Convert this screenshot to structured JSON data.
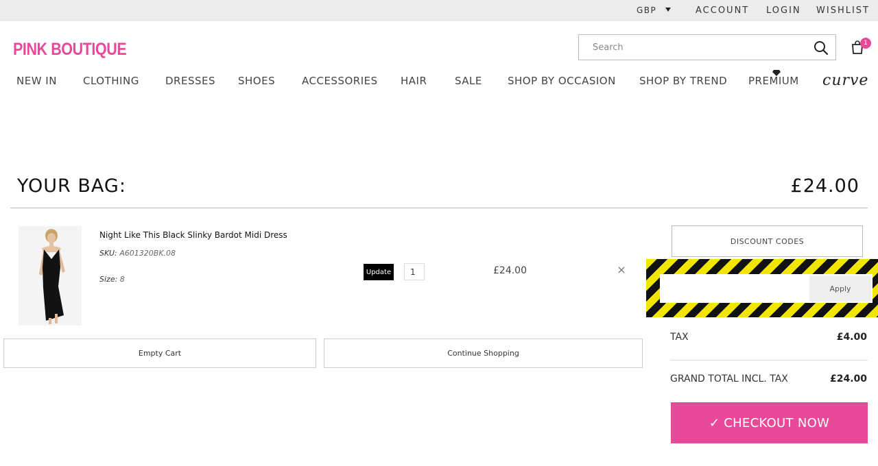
{
  "topbar": {
    "currency": "GBP",
    "links": [
      "ACCOUNT",
      "LOGIN",
      "WISHLIST"
    ]
  },
  "header": {
    "logo": "PINK BOUTIQUE",
    "search_placeholder": "Search",
    "cart_count": "1",
    "brand_color": "#e8489a"
  },
  "nav": {
    "items": [
      "NEW IN",
      "CLOTHING",
      "DRESSES",
      "SHOES",
      "ACCESSORIES",
      "HAIR",
      "SALE",
      "SHOP BY OCCASION",
      "SHOP BY TREND",
      "PREMIUM"
    ],
    "curve": "curve"
  },
  "bag": {
    "title": "YOUR BAG:",
    "total": "£24.00"
  },
  "item": {
    "name": "Night Like This Black Slinky Bardot Midi Dress",
    "sku_label": "SKU:",
    "sku": "A601320BK.08",
    "size_label": "Size:",
    "size": "8",
    "update_label": "Update",
    "quantity": "1",
    "price": "£24.00",
    "remove_glyph": "×"
  },
  "actions": {
    "empty_cart": "Empty Cart",
    "continue_shopping": "Continue Shopping"
  },
  "summary": {
    "discount_codes": "DISCOUNT CODES",
    "code_value": "",
    "apply_label": "Apply",
    "tax_label": "TAX",
    "tax_value": "£4.00",
    "grand_total_label": "GRAND TOTAL INCL. TAX",
    "grand_total_value": "£24.00",
    "checkout_label": "✓ CHECKOUT NOW"
  }
}
